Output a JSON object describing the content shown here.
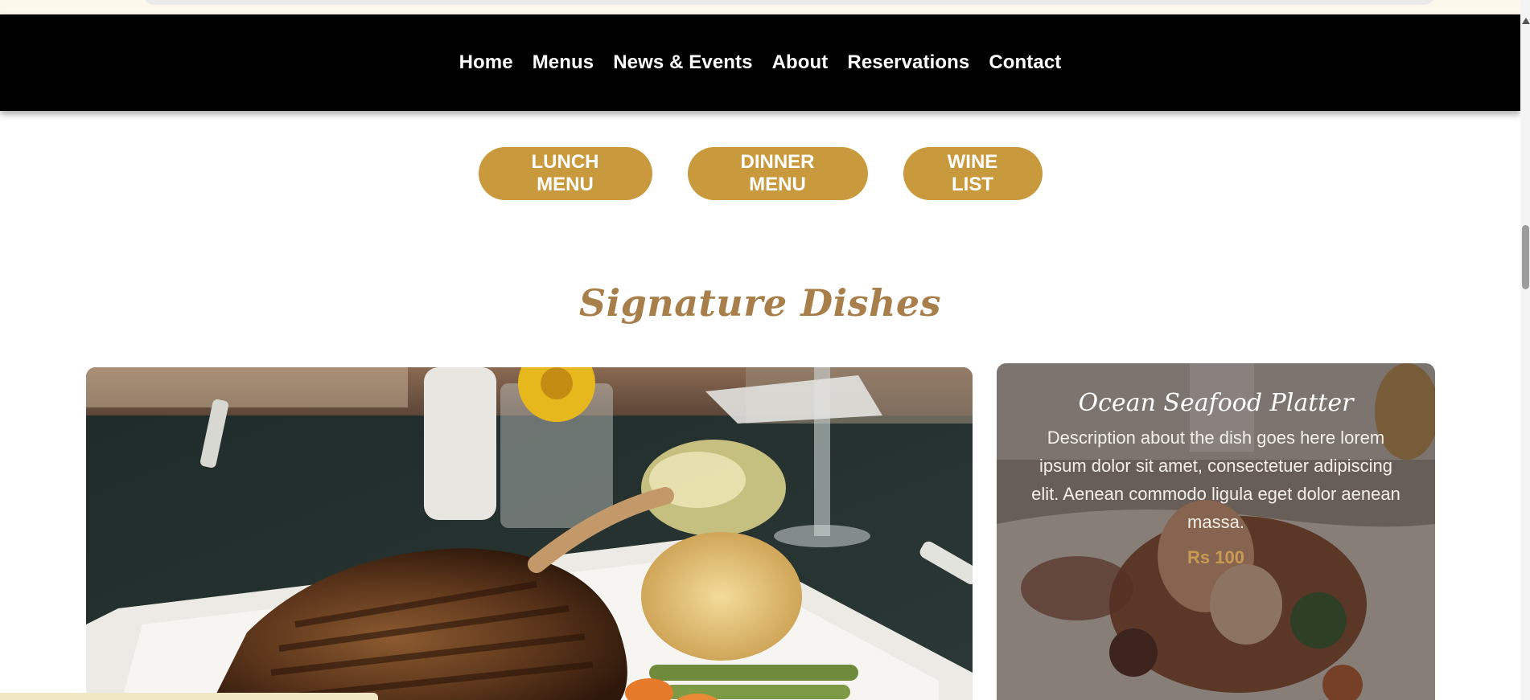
{
  "nav": {
    "items": [
      {
        "label": "Home"
      },
      {
        "label": "Menus"
      },
      {
        "label": "News & Events"
      },
      {
        "label": "About"
      },
      {
        "label": "Reservations"
      },
      {
        "label": "Contact"
      }
    ]
  },
  "menu_buttons": {
    "lunch": "LUNCH MENU",
    "dinner": "DINNER MENU",
    "wine": "WINE LIST"
  },
  "section": {
    "title": "Signature Dishes"
  },
  "featured_dish": {
    "title": "Ocean Seafood Platter",
    "description": "Description about the dish goes here lorem ipsum dolor sit amet, consectetuer adipiscing elit. Aenean commodo ligula eget dolor aenean massa.",
    "price": "Rs 100"
  },
  "colors": {
    "accent": "#c9993d",
    "title": "#a87f4a",
    "price": "#c99a52",
    "nav_bg": "#000000"
  }
}
